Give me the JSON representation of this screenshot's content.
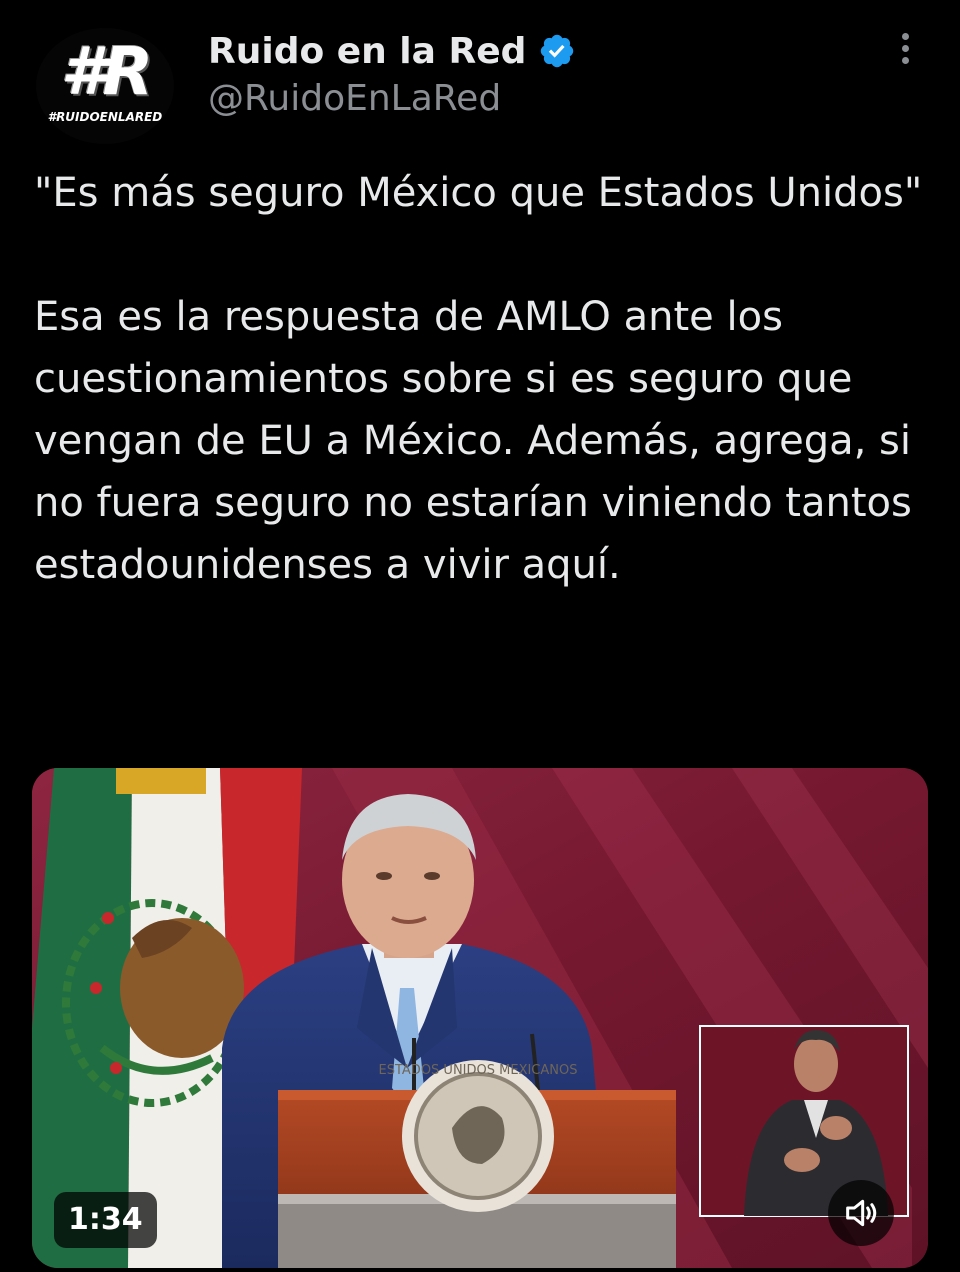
{
  "account": {
    "display_name": "Ruido en la Red",
    "handle": "@RuidoEnLaRed",
    "avatar_mark": "#R",
    "avatar_tag": "#RUIDOENLARED",
    "verified": true
  },
  "tweet": {
    "paragraphs": [
      "\"Es más seguro México que Estados Unidos\"",
      "Esa es la respuesta de AMLO ante los cuestionamientos sobre si es seguro que vengan de EU a México. Además, agrega, si no fuera seguro no estarían viniendo tantos estadounidenses a vivir aquí."
    ]
  },
  "video": {
    "duration": "1:34",
    "podium_seal_text": "ESTADOS UNIDOS MEXICANOS"
  },
  "colors": {
    "background": "#000000",
    "text": "#e7e9ea",
    "secondary": "#8b8f94",
    "verified_blue": "#1d9bf0"
  },
  "icons": [
    "more-options-icon",
    "verified-badge-icon",
    "volume-icon"
  ]
}
